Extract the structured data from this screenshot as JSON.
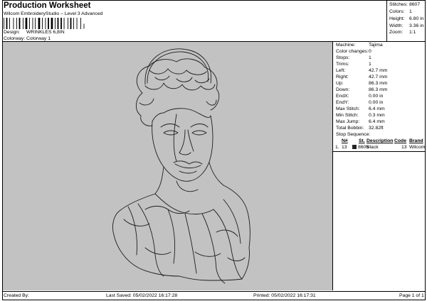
{
  "header": {
    "title": "Production Worksheet",
    "subtitle": "Wilcom EmbroideryStudio – Level 3 Advanced",
    "barcode_mark": "|",
    "design_label": "Design:",
    "design_value": "WRINKLES 6,8IN",
    "colorway_label": "Colorway:",
    "colorway_value": "Colorway 1"
  },
  "stats": [
    {
      "label": "Stitches:",
      "value": "8607"
    },
    {
      "label": "Colors:",
      "value": "1"
    },
    {
      "label": "Height:",
      "value": "6.80 in"
    },
    {
      "label": "Width:",
      "value": "3.36 in"
    },
    {
      "label": "Zoom:",
      "value": "1:1"
    }
  ],
  "machine_info": [
    {
      "label": "Machine:",
      "value": "Tajima"
    },
    {
      "label": "Color changes:",
      "value": "0"
    },
    {
      "label": "Stops:",
      "value": "1"
    },
    {
      "label": "Trims:",
      "value": "1"
    },
    {
      "label": "Left:",
      "value": "42.7 mm"
    },
    {
      "label": "Right:",
      "value": "42.7 mm"
    },
    {
      "label": "Up:",
      "value": "86.3 mm"
    },
    {
      "label": "Down:",
      "value": "86.3 mm"
    },
    {
      "label": "EndX:",
      "value": "0.00 in"
    },
    {
      "label": "EndY:",
      "value": "0.00 in"
    },
    {
      "label": "Max Stitch:",
      "value": "6.4 mm"
    },
    {
      "label": "Min Stitch:",
      "value": "0.3 mm"
    },
    {
      "label": "Max Jump:",
      "value": "6.4 mm"
    },
    {
      "label": "Total Bobbin:",
      "value": "32.82ft"
    }
  ],
  "stop_sequence": {
    "title": "Stop Sequence:",
    "columns": [
      "N#",
      "St.",
      "Description",
      "Code",
      "Brand"
    ],
    "rows": [
      {
        "num": "1.",
        "n": "13",
        "st": "8605",
        "description": "Black",
        "code": "13",
        "brand": "Wilcom",
        "color": "#222222"
      }
    ]
  },
  "footer": {
    "created_by": "Created By:",
    "last_saved": "Last Saved: 05/02/2022 16:17:28",
    "printed": "Printed: 05/02/2022 16:17:31",
    "page": "Page 1 of 1"
  },
  "colors": {
    "canvas_bg": "#c2c2c2",
    "stitch": "#1e1e1e"
  }
}
